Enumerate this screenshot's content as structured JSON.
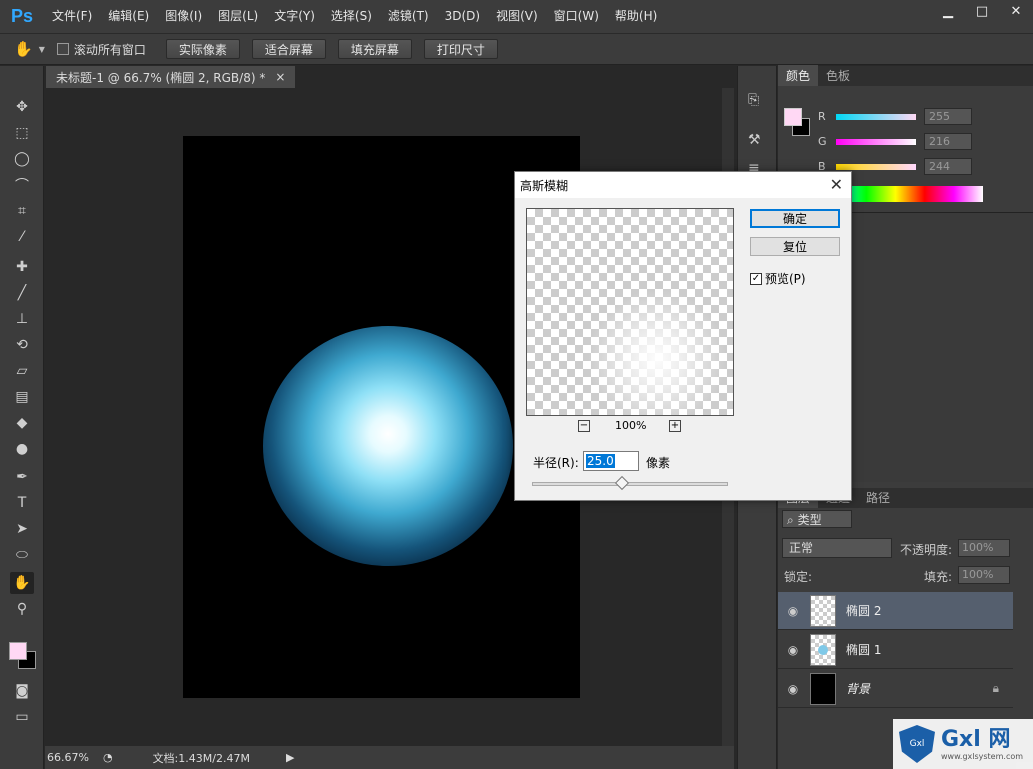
{
  "app": {
    "logo": "Ps"
  },
  "menu": [
    "文件(F)",
    "编辑(E)",
    "图像(I)",
    "图层(L)",
    "文字(Y)",
    "选择(S)",
    "滤镜(T)",
    "3D(D)",
    "视图(V)",
    "窗口(W)",
    "帮助(H)"
  ],
  "options": {
    "scroll_all_label": "滚动所有窗口",
    "buttons": [
      "实际像素",
      "适合屏幕",
      "填充屏幕",
      "打印尺寸"
    ]
  },
  "document": {
    "tab_title": "未标题-1 @ 66.7% (椭圆 2, RGB/8) *",
    "zoom": "66.67%",
    "doc_size": "文档:1.43M/2.47M"
  },
  "color_panel": {
    "tabs": [
      "颜色",
      "色板"
    ],
    "channels": [
      {
        "label": "R",
        "value": "255"
      },
      {
        "label": "G",
        "value": "216"
      },
      {
        "label": "B",
        "value": "244"
      }
    ],
    "foreground": "#ffd8f4"
  },
  "layers_panel": {
    "tabs": [
      "图层",
      "通道",
      "路径"
    ],
    "filter_kind": "类型",
    "blend_mode": "正常",
    "opacity_label": "不透明度:",
    "opacity": "100%",
    "lock_label": "锁定:",
    "fill_label": "填充:",
    "fill": "100%",
    "layers": [
      {
        "name": "椭圆 2",
        "selected": true
      },
      {
        "name": "椭圆 1",
        "selected": false
      },
      {
        "name": "背景",
        "selected": false
      }
    ]
  },
  "dialog": {
    "title": "高斯模糊",
    "ok": "确定",
    "reset": "复位",
    "preview_label": "预览(P)",
    "zoom": "100%",
    "radius_label": "半径(R):",
    "radius_value": "25.0",
    "unit": "像素"
  },
  "watermark": {
    "logo_text": "Gxl",
    "brand": "Gxl 网",
    "url": "www.gxlsystem.com"
  }
}
